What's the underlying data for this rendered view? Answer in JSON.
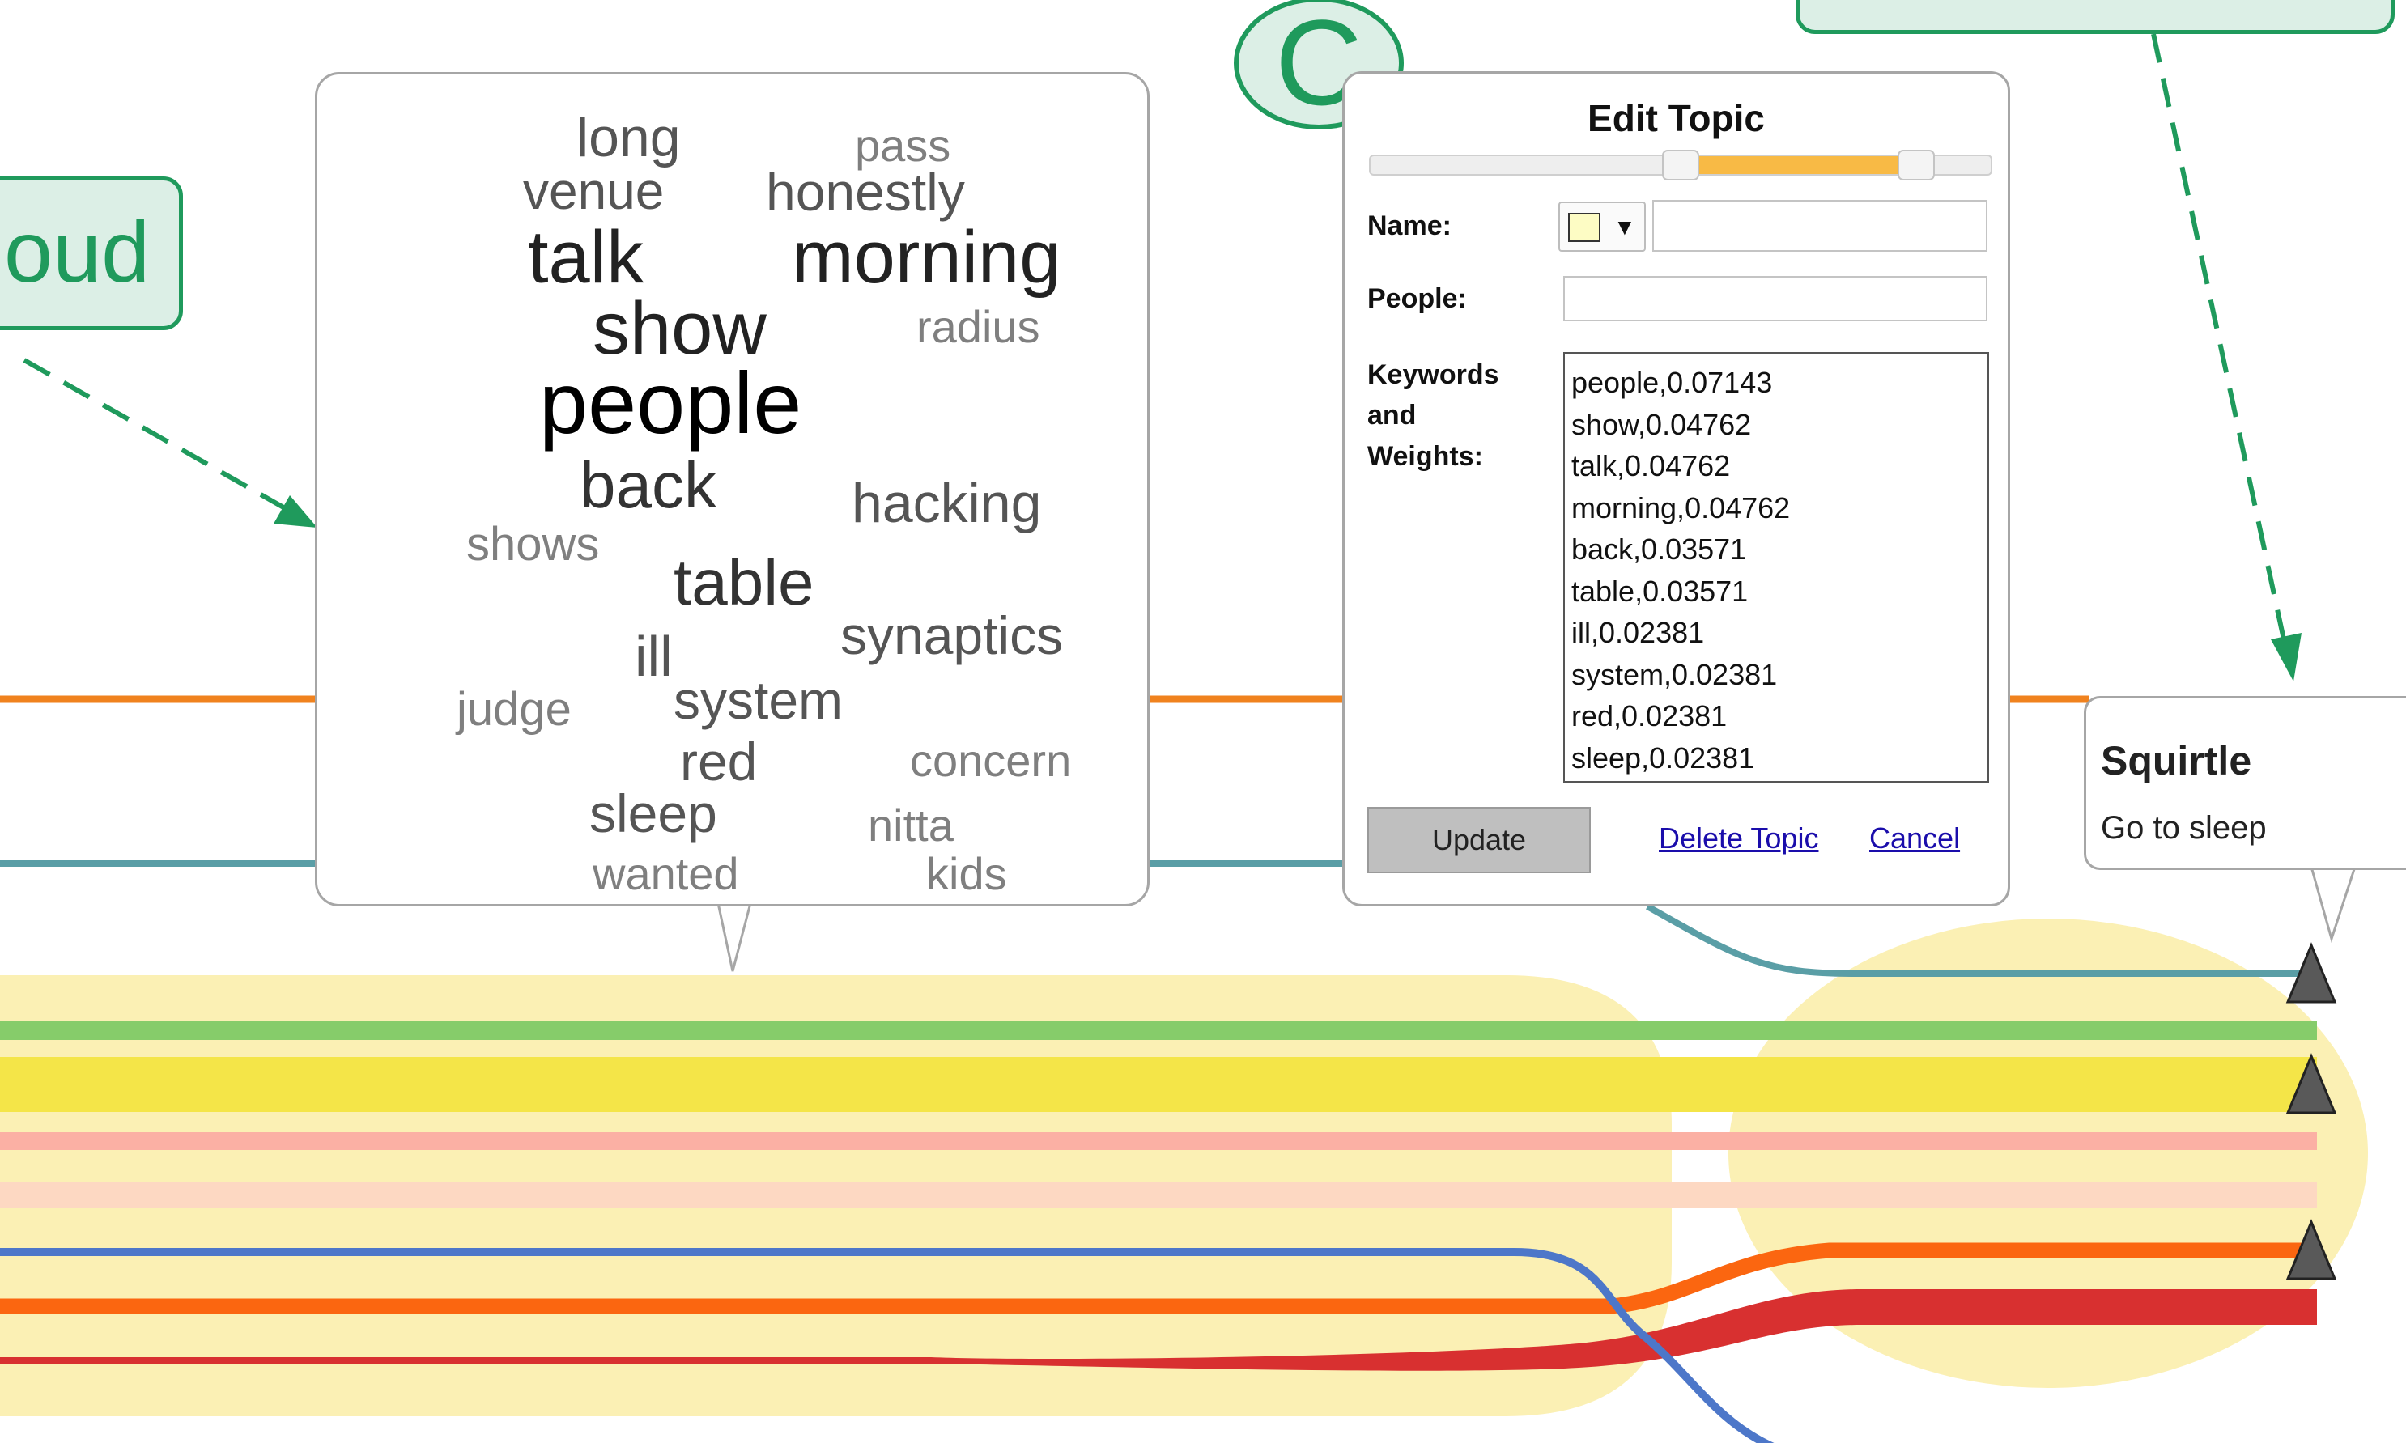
{
  "colors": {
    "callout_green": "#1f9a5c",
    "callout_fill": "#dcefe6",
    "highlight_yellow": "#fbf0b4",
    "orange_line": "#f0821e",
    "teal_line": "#5a9ea6",
    "green_band": "#86cc6a",
    "yellow_band": "#f4e548",
    "pink_band": "#fbb0a4",
    "peach_band": "#fdd8c2",
    "blue_line": "#4d77c9",
    "orange_band": "#fb6610",
    "red_band": "#d83030",
    "marker_gray": "#595959",
    "slider_range": "#f8ba45"
  },
  "callouts": {
    "cloud_label": "oud",
    "circle_label": "C"
  },
  "word_cloud": {
    "words": [
      {
        "text": "long",
        "size": 68,
        "color": "#555555"
      },
      {
        "text": "pass",
        "size": 56,
        "color": "#7f7f7f"
      },
      {
        "text": "venue",
        "size": 64,
        "color": "#555555"
      },
      {
        "text": "honestly",
        "size": 66,
        "color": "#555555"
      },
      {
        "text": "talk",
        "size": 92,
        "color": "#222222"
      },
      {
        "text": "morning",
        "size": 92,
        "color": "#222222"
      },
      {
        "text": "show",
        "size": 92,
        "color": "#222222"
      },
      {
        "text": "radius",
        "size": 56,
        "color": "#7f7f7f"
      },
      {
        "text": "people",
        "size": 108,
        "color": "#000000"
      },
      {
        "text": "back",
        "size": 80,
        "color": "#333333"
      },
      {
        "text": "hacking",
        "size": 68,
        "color": "#555555"
      },
      {
        "text": "shows",
        "size": 58,
        "color": "#7f7f7f"
      },
      {
        "text": "table",
        "size": 80,
        "color": "#333333"
      },
      {
        "text": "ill",
        "size": 70,
        "color": "#555555"
      },
      {
        "text": "synaptics",
        "size": 66,
        "color": "#555555"
      },
      {
        "text": "judge",
        "size": 58,
        "color": "#7f7f7f"
      },
      {
        "text": "system",
        "size": 66,
        "color": "#555555"
      },
      {
        "text": "red",
        "size": 66,
        "color": "#555555"
      },
      {
        "text": "concern",
        "size": 56,
        "color": "#7f7f7f"
      },
      {
        "text": "sleep",
        "size": 66,
        "color": "#555555"
      },
      {
        "text": "nitta",
        "size": 56,
        "color": "#7f7f7f"
      },
      {
        "text": "wanted",
        "size": 56,
        "color": "#7f7f7f"
      },
      {
        "text": "kids",
        "size": 56,
        "color": "#7f7f7f"
      }
    ]
  },
  "edit_topic": {
    "title": "Edit Topic",
    "name_label": "Name:",
    "color_swatch": "#fdfcc4",
    "color_arrow": "▼",
    "name_value": "",
    "people_label": "People:",
    "people_value": "",
    "keywords_label_1": "Keywords",
    "keywords_label_2": "and",
    "keywords_label_3": "Weights:",
    "keywords": [
      "people,0.07143",
      "show,0.04762",
      "talk,0.04762",
      "morning,0.04762",
      "back,0.03571",
      "table,0.03571",
      "ill,0.02381",
      "system,0.02381",
      "red,0.02381",
      "sleep,0.02381"
    ],
    "slider_range": [
      0.5,
      0.88
    ],
    "update_label": "Update",
    "delete_label": "Delete Topic",
    "cancel_label": "Cancel"
  },
  "tooltip": {
    "title": "Squirtle",
    "subtitle": "Go to sleep"
  }
}
